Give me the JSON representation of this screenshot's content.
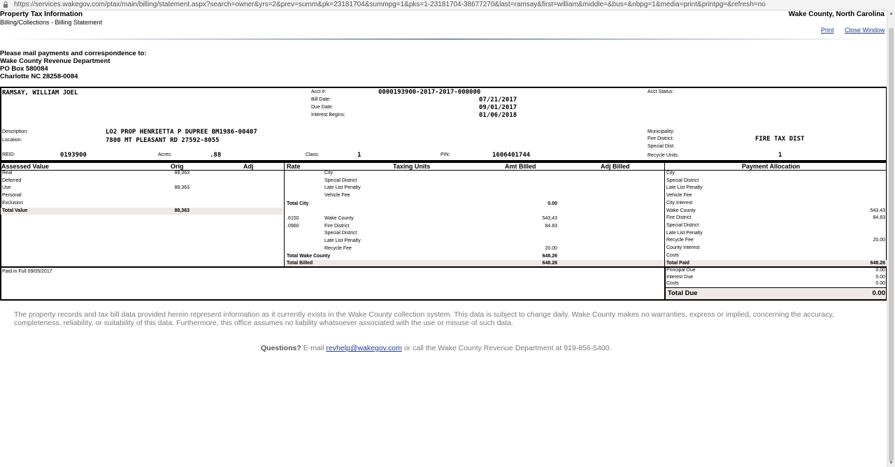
{
  "browser": {
    "url": "https://services.wakegov.com/ptax/main/billing/statement.aspx?search=owner&yrs=2&prev=summ&pk=23181704&summpg=1&pks=1-23181704-38677270&last=ramsay&first=william&middle=&bus=&nbpg=1&media=print&printpg=&refresh=no"
  },
  "header": {
    "title": "Property Tax Information",
    "subtitle": "Billing/Collections - Billing Statement",
    "county": "Wake County, North Carolina",
    "print_label": "Print",
    "close_label": "Close Window"
  },
  "mailing": {
    "heading": "Please mail payments and correspondence to:",
    "line1": "Wake County Revenue Department",
    "line2": "PO Box 580084",
    "line3": "Charlotte NC 28258-0084"
  },
  "account": {
    "owner": "RAMSAY, WILLIAM JOEL",
    "acct_label": "Acct #:",
    "acct": "0000193900-2017-2017-000000",
    "bill_date_label": "Bill Date:",
    "bill_date": "07/21/2017",
    "due_date_label": "Due Date:",
    "due_date": "09/01/2017",
    "interest_label": "Interest Begins:",
    "interest": "01/06/2018",
    "status_label": "Acct Status:",
    "desc_label": "Description:",
    "desc": "LO2 PROP HENRIETTA P DUPREE BM1986-00407",
    "loc_label": "Location:",
    "loc": "7800 MT PLEASANT RD 27592-8055",
    "muni_label": "Municipality:",
    "fire_label": "Fire District:",
    "fire": "FIRE TAX DIST",
    "special_label": "Special Dist:",
    "reid_label": "REID:",
    "reid": "0193900",
    "acres_label": "Acres:",
    "acres": ".88",
    "class_label": "Class:",
    "class": "1",
    "pin_label": "PIN:",
    "pin": "1606401744",
    "recycle_label": "Recycle Units:",
    "recycle": "1"
  },
  "assessed": {
    "h_assessed": "Assessed Value",
    "h_orig": "Orig",
    "h_adj": "Adj",
    "rows": [
      {
        "label": "Real",
        "orig": "88,363"
      },
      {
        "label": "Deferred",
        "orig": ""
      },
      {
        "label": "Use",
        "orig": "88,363"
      },
      {
        "label": "Personal",
        "orig": ""
      },
      {
        "label": "Exclusion",
        "orig": ""
      }
    ],
    "total_label": "Total Value",
    "total": "88,363"
  },
  "billing": {
    "h_rate": "Rate",
    "h_units": "Taxing Units",
    "h_amt": "Amt Billed",
    "h_adj": "Adj Billed",
    "city_rows": [
      "City",
      "Special District",
      "Late List Penalty",
      "Vehicle Fee"
    ],
    "total_city_label": "Total City",
    "total_city": "0.00",
    "county_rows": [
      {
        "rate": ".6150",
        "unit": "Wake County",
        "amt": "543.43"
      },
      {
        "rate": ".0960",
        "unit": "Fire District",
        "amt": "84.83"
      },
      {
        "rate": "",
        "unit": "Special District",
        "amt": ""
      },
      {
        "rate": "",
        "unit": "Late List Penalty",
        "amt": ""
      },
      {
        "rate": "",
        "unit": "Recycle Fee",
        "amt": "20.00"
      }
    ],
    "total_county_label": "Total Wake County",
    "total_county": "648.26",
    "total_billed_label": "Total Billed",
    "total_billed": "648.26"
  },
  "payment": {
    "heading": "Payment Allocation",
    "rows": [
      {
        "label": "City",
        "amt": ""
      },
      {
        "label": "Special District",
        "amt": ""
      },
      {
        "label": "Late List Penalty",
        "amt": ""
      },
      {
        "label": "Vehicle Fee",
        "amt": ""
      },
      {
        "label": "City Interest",
        "amt": ""
      },
      {
        "label": "Wake County",
        "amt": "543.43"
      },
      {
        "label": "Fire District",
        "amt": "84.83"
      },
      {
        "label": "Special District",
        "amt": ""
      },
      {
        "label": "Late List Penalty",
        "amt": ""
      },
      {
        "label": "Recycle Fee",
        "amt": "20.00"
      },
      {
        "label": "County Interest",
        "amt": ""
      },
      {
        "label": "Costs",
        "amt": ""
      }
    ],
    "total_paid_label": "Total Paid",
    "total_paid": "648.26",
    "due_rows": [
      {
        "label": "Principal Due",
        "amt": "0.00"
      },
      {
        "label": "Interest Due",
        "amt": "0.00"
      },
      {
        "label": "Costs",
        "amt": "0.00"
      }
    ],
    "total_due_label": "Total Due",
    "total_due": "0.00"
  },
  "paid_note": "Paid in Full 09/05/2017",
  "disclaimer": {
    "line1": "The property records and tax bill data provided herein represent information as it currently exists in the Wake County collection system. This data is subject to change daily. Wake County makes no warranties, express or implied, concerning the accuracy,",
    "line2": "completeness, reliability, or suitability of this data. Furthermore, this office assumes no liability whatsoever associated with the use or misuse of such data."
  },
  "questions": {
    "prefix": "Questions?",
    "text1": "E-mail",
    "email": "revhelp@wakegov.com",
    "text2": "or call the Wake County Revenue Department at 919-856-5400."
  }
}
